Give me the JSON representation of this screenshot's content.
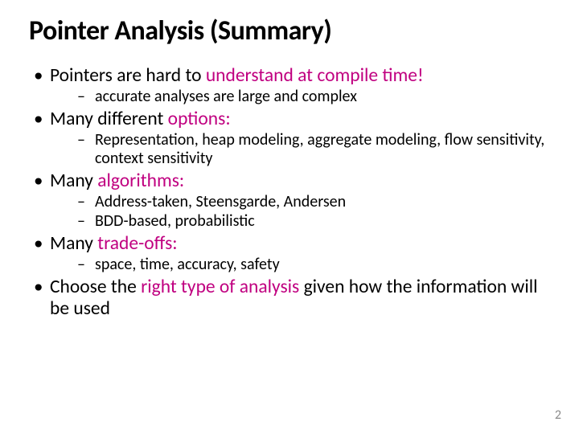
{
  "title": "Pointer Analysis (Summary)",
  "page_number": "2",
  "bullets": {
    "b1": {
      "pre": "Pointers are hard to ",
      "acc": "understand at compile time!",
      "post": ""
    },
    "b1s1": "accurate analyses are large and complex",
    "b2": {
      "pre": "Many different ",
      "acc": "options:",
      "post": ""
    },
    "b2s1": "Representation, heap modeling, aggregate modeling, flow sensitivity, context sensitivity",
    "b3": {
      "pre": "Many ",
      "acc": "algorithms:",
      "post": ""
    },
    "b3s1": "Address-taken, Steensgarde, Andersen",
    "b3s2": "BDD-based, probabilistic",
    "b4": {
      "pre": "Many ",
      "acc": "trade-offs:",
      "post": ""
    },
    "b4s1": "space, time, accuracy, safety",
    "b5": {
      "pre": "Choose the ",
      "acc": "right type of analysis",
      "post": " given how the information will be used"
    }
  }
}
